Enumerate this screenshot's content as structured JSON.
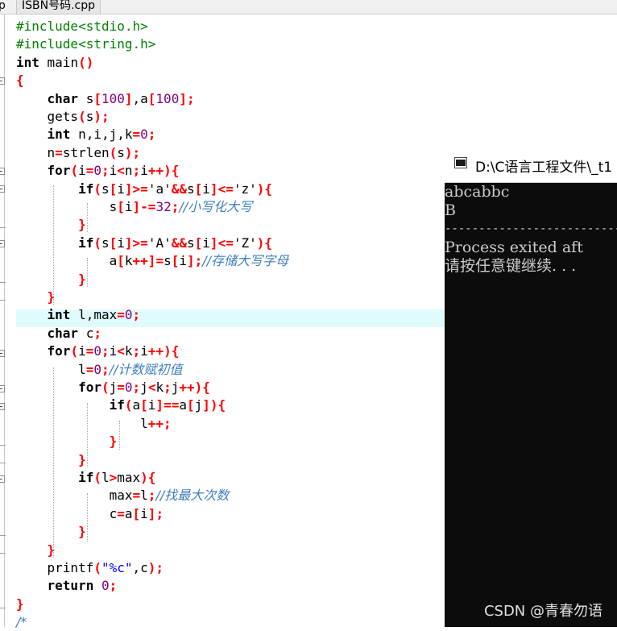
{
  "tabs": {
    "prev_tab_fragment": "p",
    "active_tab": "ISBN号码.cpp"
  },
  "code_lines": [
    "#include<stdio.h>",
    "#include<string.h>",
    "int main()",
    "{",
    "    char s[100],a[100];",
    "    gets(s);",
    "    int n,i,j,k=0;",
    "    n=strlen(s);",
    "    for(i=0;i<n;i++){",
    "        if(s[i]>='a'&&s[i]<='z'){",
    "            s[i]-=32;//小写化大写",
    "        }",
    "        if(s[i]>='A'&&s[i]<='Z'){",
    "            a[k++]=s[i];//存储大写字母",
    "        }",
    "    }",
    "    int l,max=0;",
    "    char c;",
    "    for(i=0;i<k;i++){",
    "        l=0;//计数赋初值",
    "        for(j=0;j<k;j++){",
    "            if(a[i]==a[j]){",
    "                l++;",
    "            }",
    "        }",
    "        if(l>max){",
    "            max=l;//找最大次数",
    "            c=a[i];",
    "        }",
    "    }",
    "    printf(\"%c\",c);",
    "    return 0;",
    "}",
    "/*"
  ],
  "console": {
    "title": "D:\\C语言工程文件\\_t1",
    "lines": [
      "abcabbc",
      "B"
    ],
    "separator": "--------------------------------",
    "process_line": "Process exited aft",
    "continue_line": "请按任意键继续. . ."
  },
  "watermark": "CSDN @青春勿语"
}
